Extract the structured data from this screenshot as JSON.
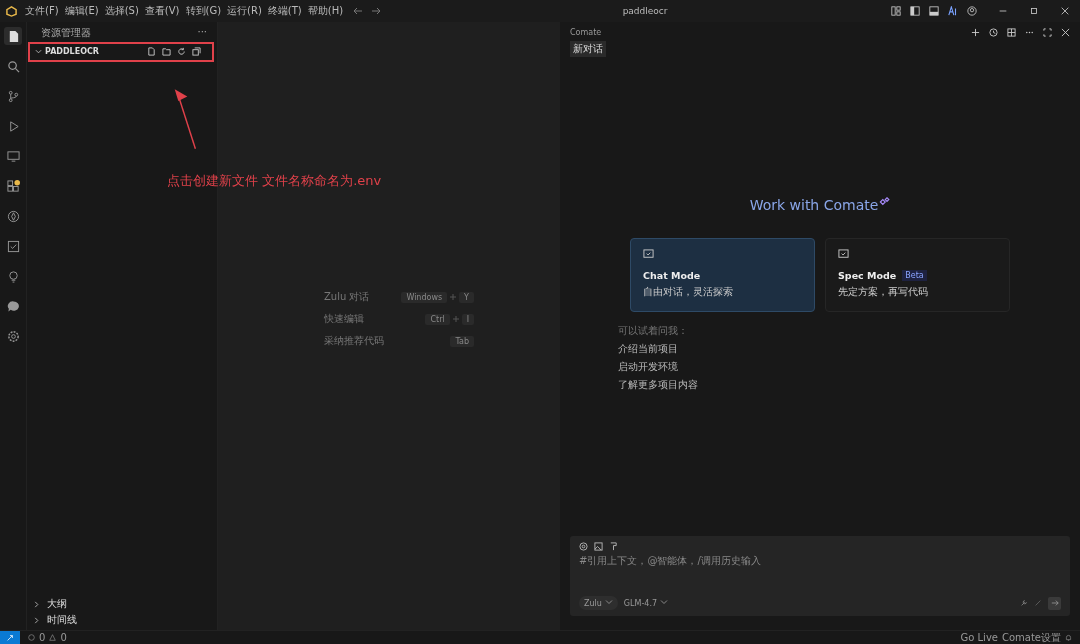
{
  "menu": [
    "文件(F)",
    "编辑(E)",
    "选择(S)",
    "查看(V)",
    "转到(G)",
    "运行(R)",
    "终端(T)",
    "帮助(H)"
  ],
  "search": {
    "value": "paddleocr"
  },
  "activity_bar": [
    {
      "kind": "files",
      "selected": true
    },
    {
      "kind": "search",
      "selected": false
    },
    {
      "kind": "branch",
      "selected": false
    },
    {
      "kind": "run",
      "selected": false
    },
    {
      "kind": "remote",
      "selected": false
    },
    {
      "kind": "extensions",
      "selected": false
    },
    {
      "kind": "compass",
      "selected": false
    },
    {
      "kind": "check",
      "selected": false
    },
    {
      "kind": "bulb",
      "selected": false
    },
    {
      "kind": "chat",
      "selected": false
    },
    {
      "kind": "gear",
      "selected": false
    }
  ],
  "sidebar": {
    "title": "资源管理器",
    "more": "···",
    "folder": "PADDLEOCR",
    "bottom": [
      "大纲",
      "时间线"
    ]
  },
  "annotation": {
    "text": "点击创建新文件 文件名称命名为.env"
  },
  "shortcuts": [
    {
      "label": "Zulu 对话",
      "keys": [
        "Windows",
        "Y"
      ]
    },
    {
      "label": "快速编辑",
      "keys": [
        "Ctrl",
        "I"
      ]
    },
    {
      "label": "采纳推荐代码",
      "keys": [
        "Tab"
      ]
    }
  ],
  "chat": {
    "title": "Comate",
    "tab": "新对话",
    "heading": "Work with Comate",
    "modes": [
      {
        "title": "Chat Mode",
        "subtitle": "自由对话，灵活探索",
        "selected": true
      },
      {
        "title": "Spec Mode",
        "badge": "Beta",
        "subtitle": "先定方案，再写代码",
        "selected": false
      }
    ],
    "suggest_title": "可以试着问我：",
    "suggestions": [
      "介绍当前项目",
      "启动开发环境",
      "了解更多项目内容"
    ],
    "input": {
      "placeholder": "#引用上下文，@智能体，/调用历史输入",
      "agent": "Zulu",
      "model": "GLM-4.7"
    }
  },
  "status_bar": {
    "errors": "0",
    "warnings": "0",
    "go_live": "Go Live",
    "comate": "Comate设置"
  }
}
